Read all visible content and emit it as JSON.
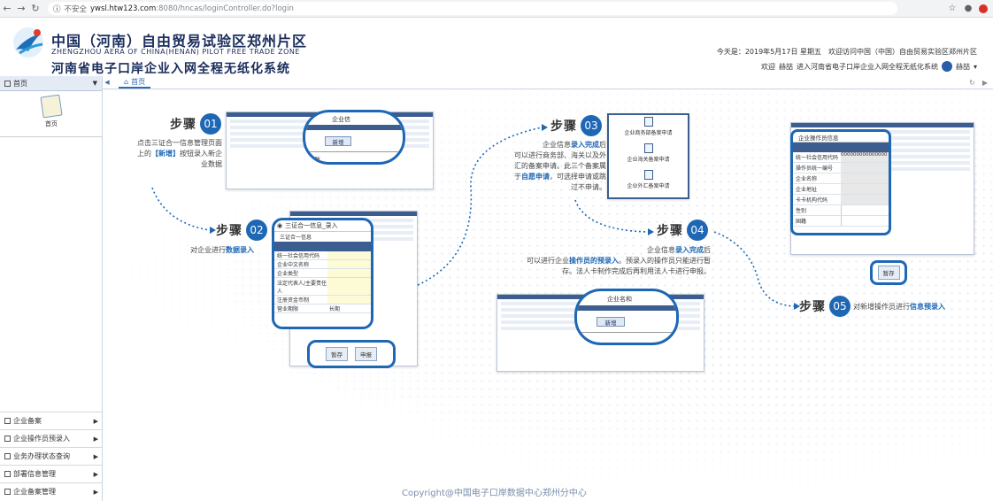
{
  "browser": {
    "back": "←",
    "forward": "→",
    "reload": "C",
    "security": "不安全",
    "url_host": "ywsl.htw123.com",
    "url_path": ":8080/hncas/loginController.do?login"
  },
  "header": {
    "title_cn": "中国（河南）自由贸易试验区郑州片区",
    "title_en": "ZHENGZHOU AERA OF CHINA(HENAN) PILOT FREE TRADE ZONE",
    "system_name": "河南省电子口岸企业入网全程无纸化系统",
    "date_line": "今天是：2019年5月17日 星期五　欢迎访问中国（中国）自由贸易实验区郑州片区",
    "welcome": "欢迎",
    "user": "赫喆",
    "welcome_tail": "进入河南省电子口岸企业入网全程无纸化系统",
    "user_menu": "赫喆"
  },
  "sidebar": {
    "top_label": "首页",
    "home_label": "首页",
    "items": [
      {
        "label": "企业备案"
      },
      {
        "label": "企业操作员预录入"
      },
      {
        "label": "业务办理状态查询"
      },
      {
        "label": "部署信息管理"
      },
      {
        "label": "企业备案管理"
      }
    ]
  },
  "tabs": {
    "home": "首页"
  },
  "steps": [
    {
      "word": "步骤",
      "num": "01"
    },
    {
      "word": "步骤",
      "num": "02"
    },
    {
      "word": "步骤",
      "num": "03"
    },
    {
      "word": "步骤",
      "num": "04"
    },
    {
      "word": "步骤",
      "num": "05"
    }
  ],
  "descs": {
    "s1_a": "点击三证合一信息管理页面",
    "s1_b": "上的",
    "s1_hl": "【新增】",
    "s1_c": "按钮录入新企",
    "s1_d": "业数据",
    "s2_a": "对企业进行",
    "s2_hl": "数据录入",
    "s3_a": "企业信息",
    "s3_hl": "录入完成",
    "s3_b": "后",
    "s3_c": "可以进行商务部、海关以及外",
    "s3_d": "汇的备案申请。此三个备案属",
    "s3_e": "于",
    "s3_hl2": "自愿申请",
    "s3_f": "，可选择申请或跳",
    "s3_g": "过不申请。",
    "s4_a": "企业信息",
    "s4_hl": "录入完成",
    "s4_b": "后",
    "s4_c": "可以进行企业",
    "s4_hl2": "操作员的预录入",
    "s4_d": "。预录入的操作员只能进行暂",
    "s4_e": "存。法人卡制作完成后再利用法人卡进行申报。",
    "s5_a": "对新增操作员进行",
    "s5_hl": "信息预录入"
  },
  "shot1": {
    "corner": "企业信",
    "add_btn": "新增",
    "row": "立账"
  },
  "form2": {
    "title": "三证合一信息_录入",
    "section": "三证合一信息",
    "fields": [
      "统一社会信用代码",
      "企业中文名称",
      "企业类型",
      "法定代表人/主要责任人",
      "注册资金币制",
      "营业期限"
    ],
    "field_value": "长期",
    "btn_save": "暂存",
    "btn_submit": "申报"
  },
  "card3": {
    "items": [
      "企业商务部备案申请",
      "企业海关备案申请",
      "企业外汇备案申请"
    ]
  },
  "shot4": {
    "corner": "企业名和",
    "add_btn": "新增",
    "row": "表"
  },
  "form5": {
    "title": "企业操作员信息",
    "fields": [
      "统一社会信用代码",
      "操作员统一编号",
      "企业名称",
      "企业地址",
      "卡卡机构代码",
      "性别",
      "国籍"
    ],
    "code_value": "000000000000000",
    "btn_save": "暂存"
  },
  "footer": "Copyright@中国电子口岸数据中心郑州分中心"
}
